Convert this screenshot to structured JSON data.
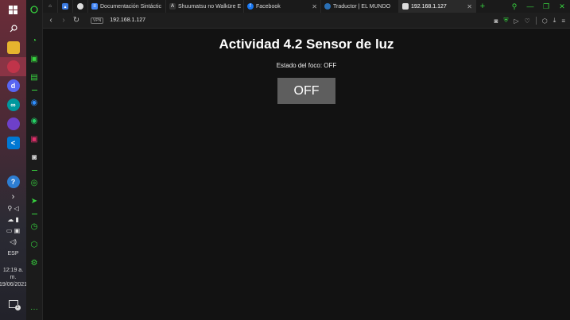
{
  "browser": {
    "tabs": [
      {
        "label": "",
        "icon": "gamepad-icon"
      },
      {
        "label": "",
        "icon": "image-icon"
      },
      {
        "label": "",
        "icon": "github-icon"
      },
      {
        "label": "Documentación Sintáctic",
        "icon": "docs-icon"
      },
      {
        "label": "Shuumatsu no Walküre E",
        "icon": "anime-icon"
      },
      {
        "label": "Facebook",
        "icon": "facebook-icon"
      },
      {
        "label": "Traductor | EL MUNDO",
        "icon": "globe-icon"
      },
      {
        "label": "192.168.1.127",
        "icon": "page-icon"
      }
    ],
    "vpn_label": "VPN",
    "url": "192.168.1.127"
  },
  "page": {
    "title": "Actividad 4.2 Sensor de luz",
    "status_text": "Estado del foco: OFF",
    "button_label": "OFF"
  },
  "taskbar": {
    "language": "ESP",
    "time": "12:19 a. m.",
    "date": "19/06/2021",
    "notification_count": "1"
  },
  "colors": {
    "accent": "#37d43f",
    "page_bg": "#121212",
    "button_bg": "#5e5e5e"
  }
}
